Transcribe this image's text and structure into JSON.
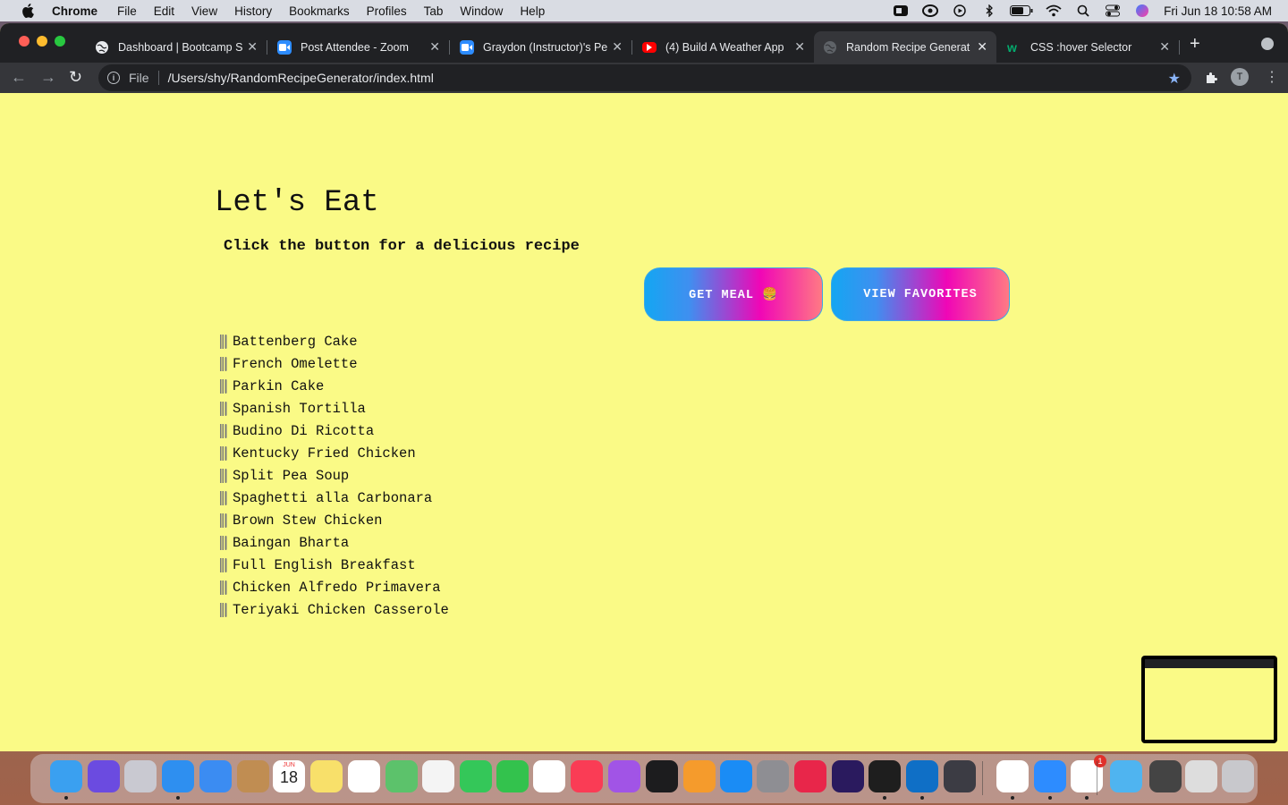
{
  "menubar": {
    "app_name": "Chrome",
    "menus": [
      "File",
      "Edit",
      "View",
      "History",
      "Bookmarks",
      "Profiles",
      "Tab",
      "Window",
      "Help"
    ],
    "clock": "Fri Jun 18  10:58 AM"
  },
  "browser": {
    "tabs": [
      {
        "title": "Dashboard | Bootcamp S",
        "icon": "globe-icon"
      },
      {
        "title": "Post Attendee - Zoom",
        "icon": "zoom-icon"
      },
      {
        "title": "Graydon (Instructor)'s Pe",
        "icon": "zoom-icon"
      },
      {
        "title": "(4) Build A Weather App",
        "icon": "youtube-icon"
      },
      {
        "title": "Random Recipe Generat",
        "icon": "globe-icon",
        "active": true
      },
      {
        "title": "CSS :hover Selector",
        "icon": "w3schools-icon"
      }
    ],
    "address": {
      "scheme": "File",
      "url": "/Users/shy/RandomRecipeGenerator/index.html"
    },
    "profile_initial": "T"
  },
  "page": {
    "title": "Let's Eat",
    "subtitle": "Click the button for a delicious recipe",
    "get_meal_label": "GET MEAL 🍔",
    "view_favorites_label": "VIEW FAVORITES",
    "meals": [
      "Battenberg Cake",
      "French Omelette",
      "Parkin Cake",
      "Spanish Tortilla",
      "Budino Di Ricotta",
      "Kentucky Fried Chicken",
      "Split Pea Soup",
      "Spaghetti alla Carbonara",
      "Brown Stew Chicken",
      "Baingan Bharta",
      "Full English Breakfast",
      "Chicken Alfredo Primavera",
      "Teriyaki Chicken Casserole"
    ],
    "background_color": "#fafa86"
  },
  "dock": {
    "calendar_month": "JUN",
    "calendar_day": "18",
    "slack_badge": "1"
  }
}
